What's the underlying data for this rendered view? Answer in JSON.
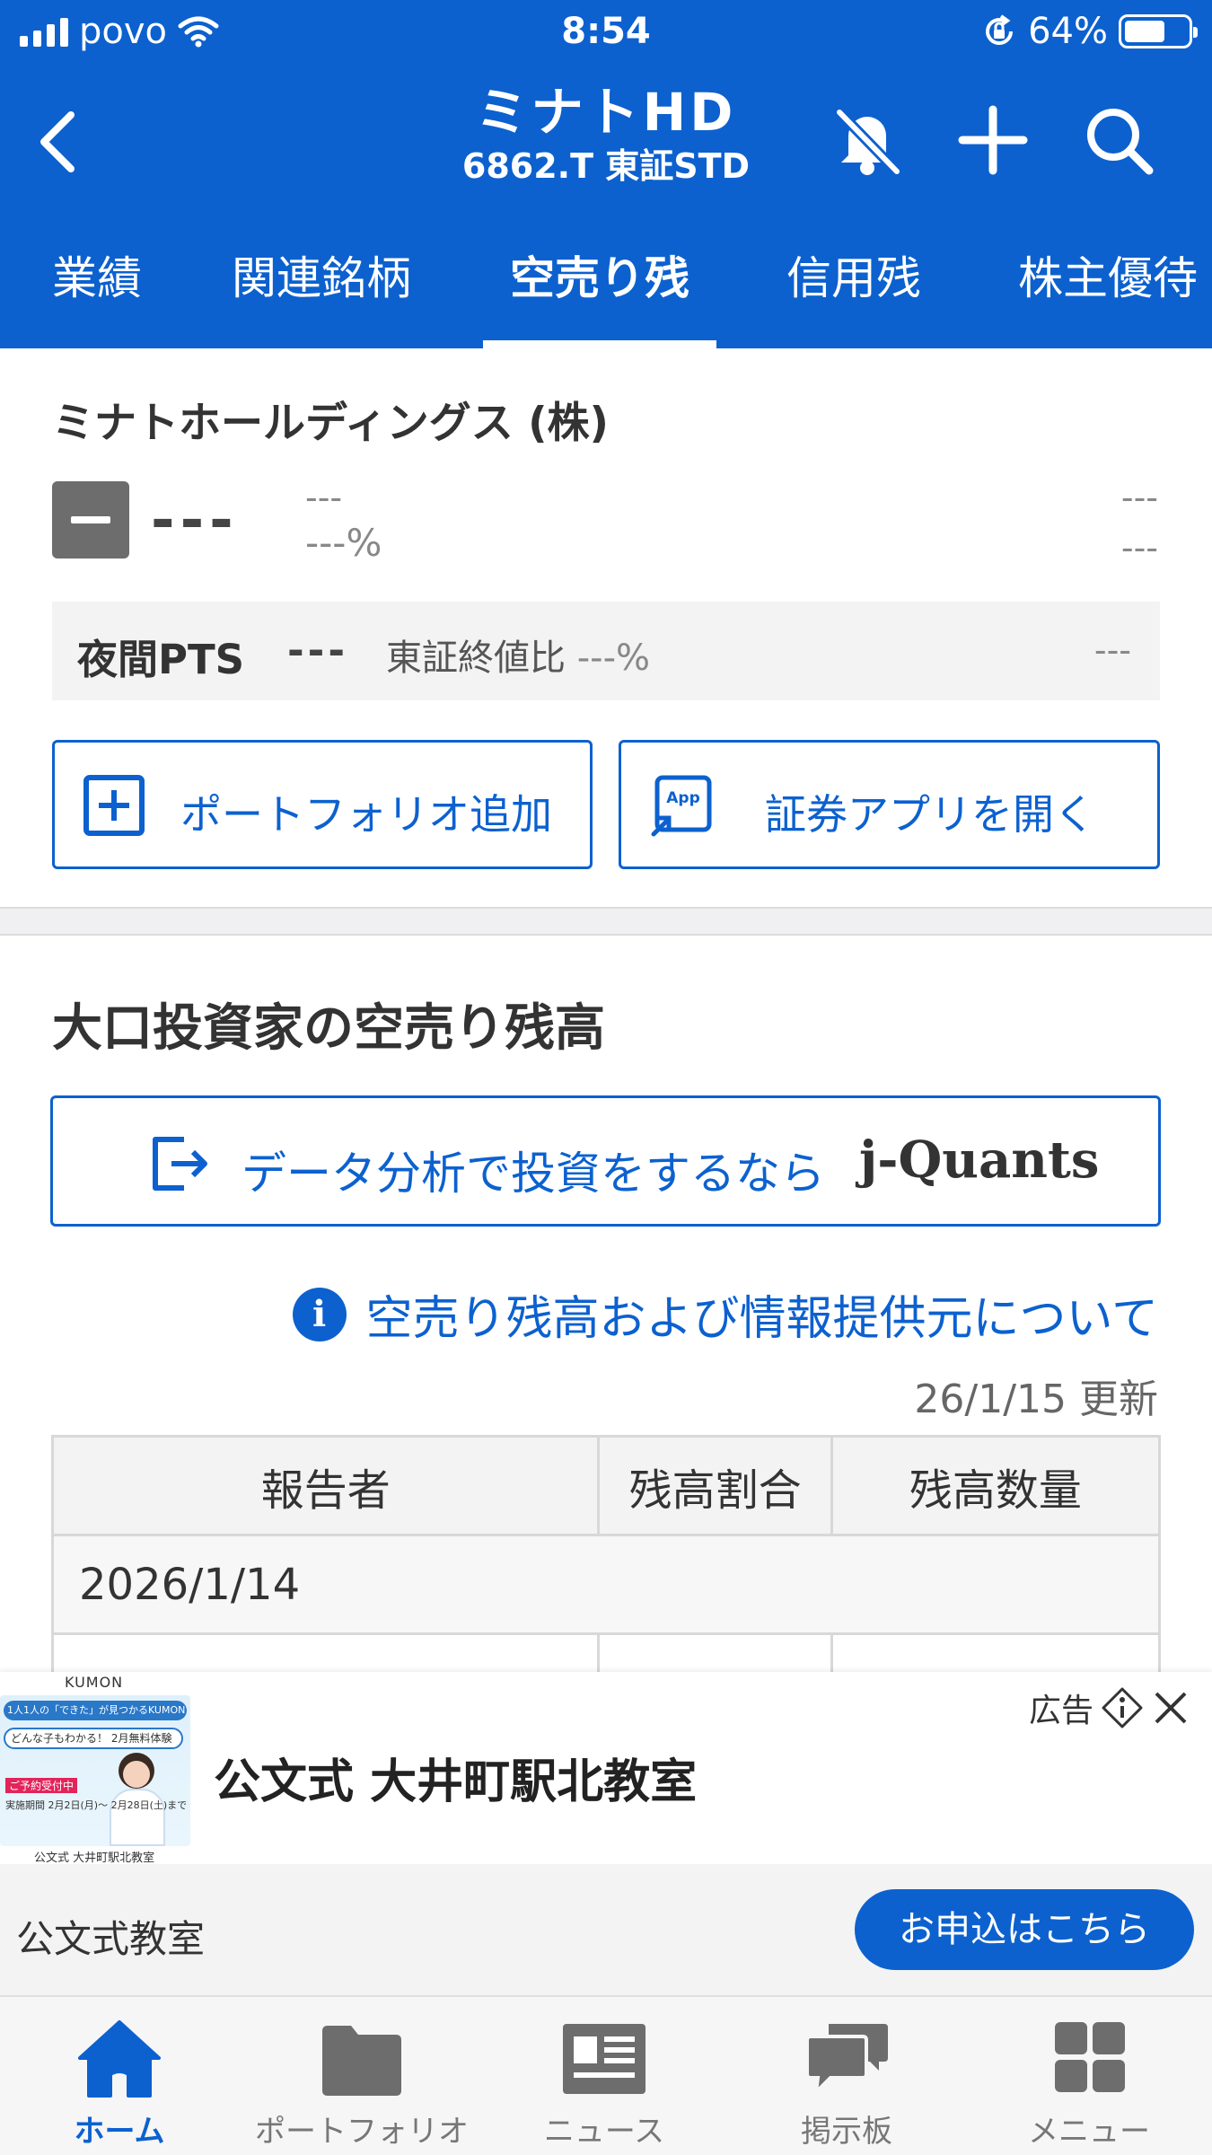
{
  "status_bar": {
    "carrier": "povo",
    "time": "8:54",
    "battery": "64%",
    "battery_level": 0.64
  },
  "nav": {
    "title": "ミナトHD",
    "subtitle": "6862.T 東証STD"
  },
  "tabs": [
    {
      "label": "業績"
    },
    {
      "label": "関連銘柄"
    },
    {
      "label": "空売り残",
      "active": true
    },
    {
      "label": "信用残"
    },
    {
      "label": "株主優待"
    }
  ],
  "stock": {
    "company_name": "ミナトホールディングス (株)",
    "price": "---",
    "change": "---",
    "change_pct": "---%",
    "right_value_1": "---",
    "right_value_2": "---"
  },
  "pts": {
    "label": "夜間PTS",
    "price": "---",
    "compare_label": "東証終値比",
    "compare_value": "---%",
    "right_value": "---"
  },
  "actions": {
    "portfolio_label": "ポートフォリオ追加",
    "app_label": "証券アプリを開く",
    "app_icon_text": "App"
  },
  "short_selling": {
    "title": "大口投資家の空売り残高",
    "banner_text": "データ分析で投資をするなら",
    "banner_logo": "j-Quants",
    "info_link": "空売り残高および情報提供元について",
    "updated": "26/1/15 更新",
    "table": {
      "headers": [
        "報告者",
        "残高割合",
        "残高数量"
      ],
      "date_row": "2026/1/14"
    }
  },
  "ad": {
    "brand": "KUMON",
    "image_strip": "1人1人の「できた」が見つかるKUMON",
    "image_pill": "どんな子もわかる！ 2月無料体験",
    "image_tag1": "ご予約受付中",
    "image_tag2": "実施期間 2月2日(月)〜 2月28日(土)まで",
    "image_caption": "公文式 大井町駅北教室",
    "label": "広告",
    "title": "公文式 大井町駅北教室",
    "sponsor": "公文式教室",
    "cta": "お申込はこちら"
  },
  "tabbar": [
    {
      "label": "ホーム",
      "icon": "home-icon",
      "active": true
    },
    {
      "label": "ポートフォリオ",
      "icon": "folder-icon"
    },
    {
      "label": "ニュース",
      "icon": "news-icon"
    },
    {
      "label": "掲示板",
      "icon": "chat-icon"
    },
    {
      "label": "メニュー",
      "icon": "menu-grid-icon"
    }
  ],
  "colors": {
    "brand_blue": "#0c61cf",
    "text": "#333333",
    "muted": "#888888"
  }
}
